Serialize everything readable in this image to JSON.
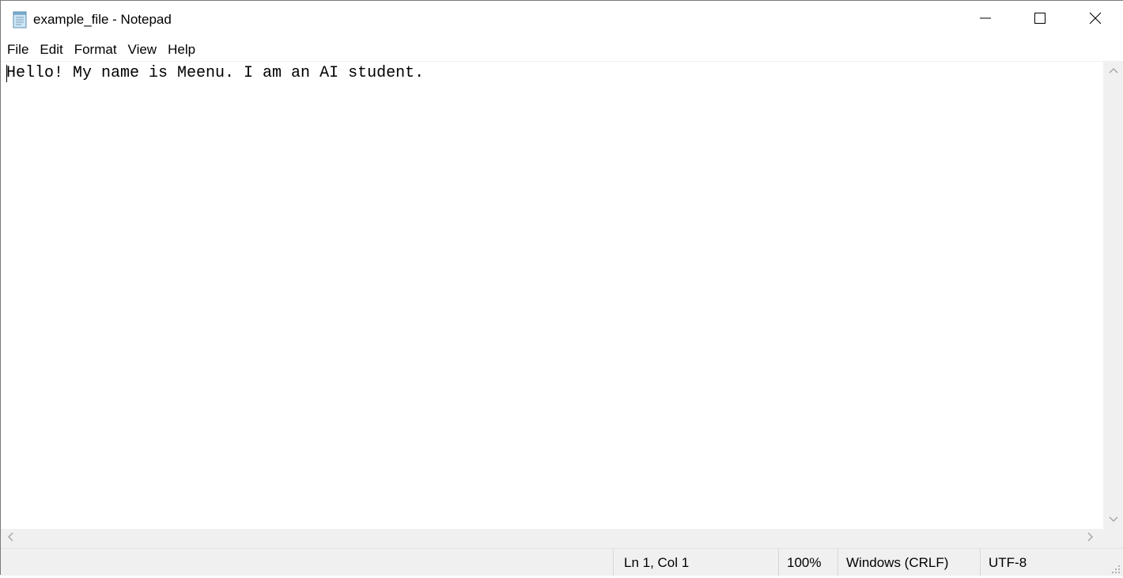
{
  "window": {
    "title": "example_file - Notepad"
  },
  "icons": {
    "app": "notepad-icon",
    "minimize": "minimize-icon",
    "maximize": "maximize-icon",
    "close": "close-icon"
  },
  "menubar": {
    "items": [
      {
        "label": "File"
      },
      {
        "label": "Edit"
      },
      {
        "label": "Format"
      },
      {
        "label": "View"
      },
      {
        "label": "Help"
      }
    ]
  },
  "editor": {
    "content": "Hello! My name is Meenu. I am an AI student."
  },
  "statusbar": {
    "position": "Ln 1, Col 1",
    "zoom": "100%",
    "line_ending": "Windows (CRLF)",
    "encoding": "UTF-8"
  },
  "colors": {
    "chrome_background": "#f0f0f0",
    "editor_background": "#ffffff",
    "text": "#000000"
  }
}
